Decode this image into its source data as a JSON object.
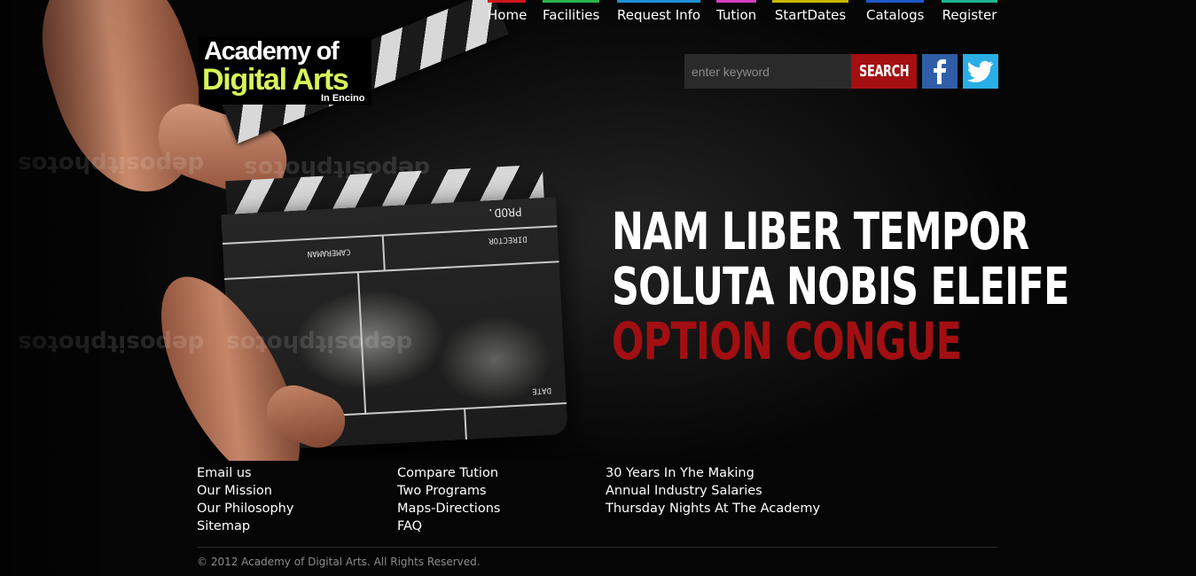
{
  "nav": {
    "items": [
      {
        "label": "Home",
        "color": "#d0161b"
      },
      {
        "label": "Facilities",
        "color": "#2db34a"
      },
      {
        "label": "Request Info",
        "color": "#1e90d6"
      },
      {
        "label": "Tution",
        "color": "#d33fc0"
      },
      {
        "label": "StartDates",
        "color": "#c9b600"
      },
      {
        "label": "Catalogs",
        "color": "#1d58c9"
      },
      {
        "label": "Register",
        "color": "#1bb58f"
      }
    ]
  },
  "logo": {
    "line1": "Academy of",
    "line2": "Digital Arts",
    "line3": "In Encino",
    "accent_color": "#d6f55a"
  },
  "search": {
    "placeholder": "enter keyword",
    "button_label": "SEARCH",
    "button_color": "#a50f12"
  },
  "social": {
    "facebook_icon": "facebook-icon",
    "twitter_icon": "twitter-icon",
    "facebook_color": "#2f5ea6",
    "twitter_color": "#29aee6"
  },
  "hero": {
    "line1": "NAM LIBER TEMPOR",
    "line2": "SOLUTA NOBIS ELEIFE",
    "line3": "OPTION CONGUE",
    "accent_color": "#a20f12",
    "clapboard": {
      "prod": "PROD.",
      "director": "DIRECTOR",
      "cameraman": "CAMERAMAN",
      "date": "DATE"
    },
    "watermark": "depositphotos"
  },
  "footer": {
    "col1": [
      "Email us",
      "Our Mission",
      "Our Philosophy",
      "Sitemap"
    ],
    "col2": [
      "Compare Tution",
      "Two Programs",
      "Maps-Directions",
      "FAQ"
    ],
    "col3": [
      "30 Years In Yhe Making",
      "Annual Industry Salaries",
      "Thursday Nights At The Academy"
    ],
    "copyright": "© 2012 Academy of Digital Arts. All Rights Reserved."
  }
}
